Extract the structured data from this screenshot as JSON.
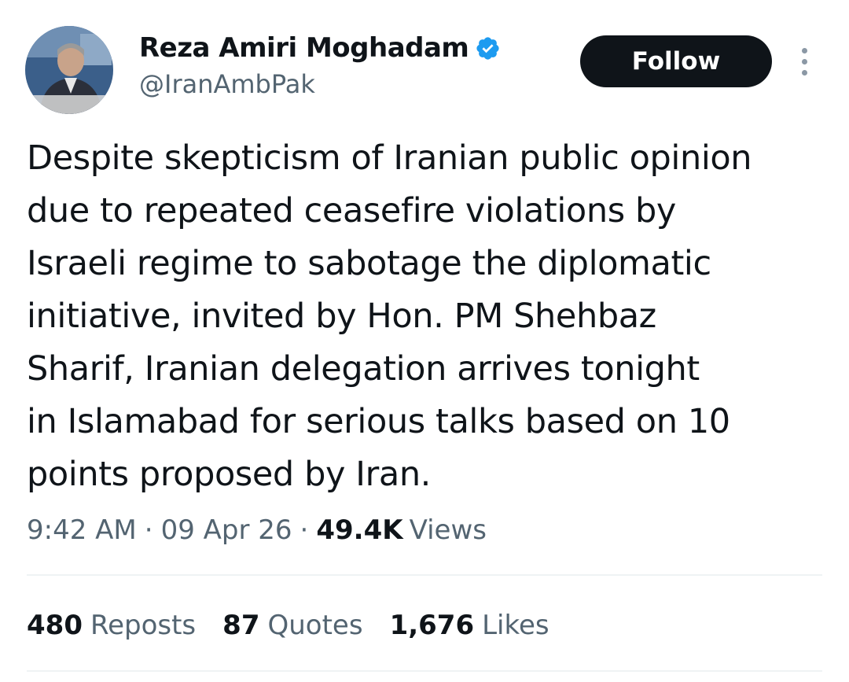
{
  "author": {
    "display_name": "Reza Amiri Moghadam",
    "handle": "@IranAmbPak",
    "verified": true,
    "verified_color": "#1d9bf0"
  },
  "header": {
    "follow_label": "Follow"
  },
  "tweet": {
    "text_lines": [
      "Despite skepticism of Iranian public opinion",
      "due to repeated ceasefire violations by",
      "Israeli regime to sabotage the diplomatic",
      "initiative, invited by Hon. PM Shehbaz",
      "Sharif, Iranian delegation arrives tonight",
      "in Islamabad for serious talks based on 10",
      "points proposed by Iran."
    ]
  },
  "meta": {
    "time": "9:42 AM",
    "separator": "·",
    "date": "09 Apr 26",
    "views_count": "49.4K",
    "views_label": "Views"
  },
  "stats": {
    "reposts_count": "480",
    "reposts_label": "Reposts",
    "quotes_count": "87",
    "quotes_label": "Quotes",
    "likes_count": "1,676",
    "likes_label": "Likes"
  },
  "icons": {
    "avatar": "profile-photo",
    "verified": "verified-badge-icon",
    "more": "more-options-icon"
  }
}
